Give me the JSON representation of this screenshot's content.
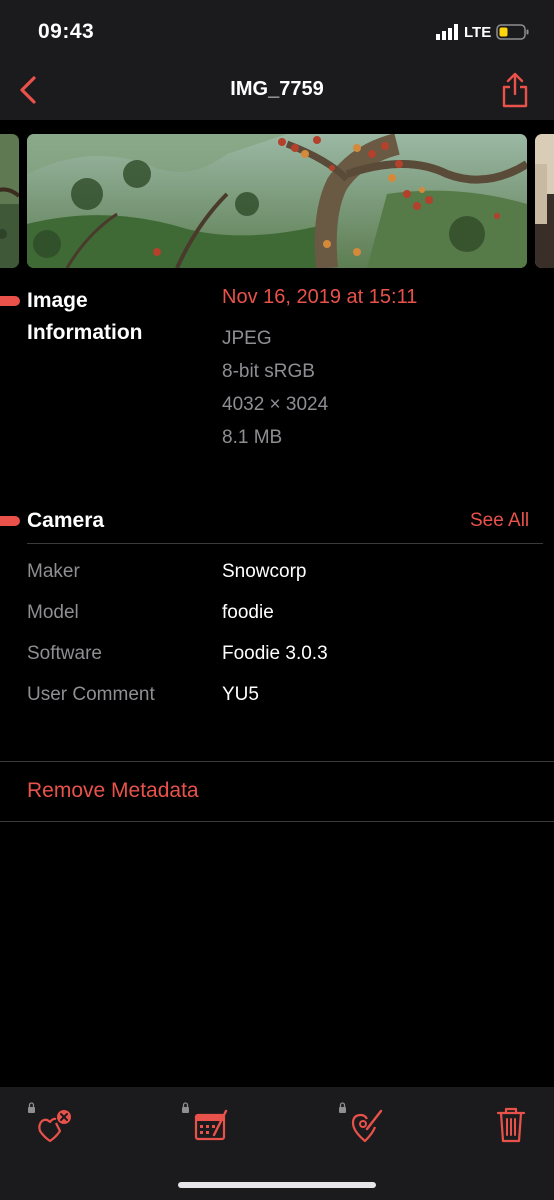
{
  "status_bar": {
    "time": "09:43",
    "network": "LTE"
  },
  "nav": {
    "title": "IMG_7759"
  },
  "image_info": {
    "heading": "Image Information",
    "date": "Nov 16, 2019 at 15:11",
    "format": "JPEG",
    "color_profile": "8-bit sRGB",
    "dimensions": "4032 × 3024",
    "file_size": "8.1 MB"
  },
  "camera": {
    "heading": "Camera",
    "see_all": "See All",
    "rows": [
      {
        "label": "Maker",
        "value": "Snowcorp"
      },
      {
        "label": "Model",
        "value": "foodie"
      },
      {
        "label": "Software",
        "value": "Foodie 3.0.3"
      },
      {
        "label": "User Comment",
        "value": "YU5"
      }
    ]
  },
  "actions": {
    "remove_metadata": "Remove Metadata"
  },
  "toolbar": {
    "icons": [
      "tag-remove-icon",
      "calendar-edit-icon",
      "location-edit-icon",
      "trash-icon"
    ]
  },
  "colors": {
    "accent": "#e8524a",
    "background": "#000000",
    "bar": "#1b1b1d",
    "secondary_text": "#8e8e93"
  }
}
